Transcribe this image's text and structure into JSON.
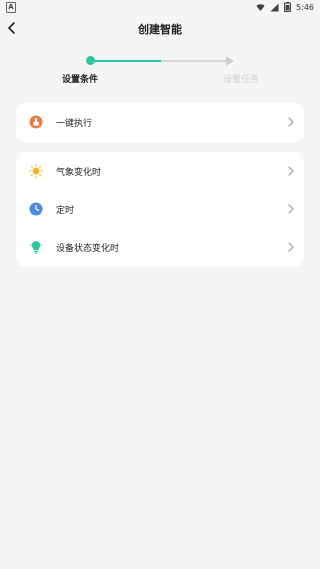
{
  "status_bar": {
    "time": "5:46",
    "app_icon_letter": "A"
  },
  "header": {
    "title": "创建智能"
  },
  "stepper": {
    "steps": [
      {
        "label": "设置条件",
        "state": "active"
      },
      {
        "label": "设置任务",
        "state": "inactive"
      }
    ],
    "active_color": "#2bc8a0",
    "inactive_color": "#d9d9d9"
  },
  "cards": {
    "manual": {
      "items": [
        {
          "label": "一键执行",
          "icon": "hand-tap-icon"
        }
      ]
    },
    "auto": {
      "items": [
        {
          "label": "气象变化时",
          "icon": "sun-icon"
        },
        {
          "label": "定时",
          "icon": "clock-icon"
        },
        {
          "label": "设备状态变化时",
          "icon": "bulb-icon"
        }
      ]
    }
  }
}
